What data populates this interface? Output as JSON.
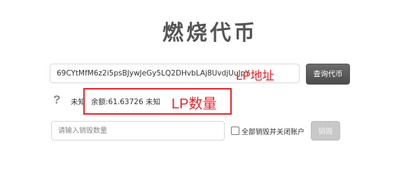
{
  "page": {
    "title": "燃烧代币"
  },
  "lp_address": {
    "value": "69CYtMfM6z2i5psBJywJeGy5LQ2DHvbLAj8UvdjUuJpY"
  },
  "query_button": {
    "label": "查询代币"
  },
  "annotations": {
    "lp_address_label": "LP地址",
    "lp_quantity_label": "LP数量",
    "highlight_color": "#e8222a"
  },
  "status": {
    "help_icon": "?",
    "left_text": "未知",
    "balance_text": "余额:61.63726 未知"
  },
  "burn": {
    "placeholder": "请输入销毁数量",
    "checkbox_label": "全部销毁并关闭账户",
    "checkbox_checked": false,
    "button_label": "销毁"
  }
}
